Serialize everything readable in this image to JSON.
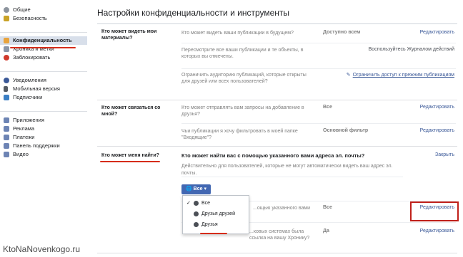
{
  "sidebar": {
    "group1": [
      {
        "label": "Общие",
        "icon": "gear-icon",
        "color": "#7f8c8d"
      },
      {
        "label": "Безопасность",
        "icon": "shield-icon",
        "color": "#c9a227"
      }
    ],
    "group2": [
      {
        "label": "Конфиденциальность",
        "icon": "lock-icon",
        "color": "#e8a33c",
        "active": true
      },
      {
        "label": "Хроника и метки",
        "icon": "timeline-icon",
        "color": "#8a96a8"
      },
      {
        "label": "Заблокировать",
        "icon": "block-icon",
        "color": "#d0392b"
      }
    ],
    "group3": [
      {
        "label": "Уведомления",
        "icon": "globe-icon",
        "color": "#3b5998"
      },
      {
        "label": "Мобильная версия",
        "icon": "mobile-icon",
        "color": "#555b63"
      },
      {
        "label": "Подписчики",
        "icon": "rss-icon",
        "color": "#3b7fc4"
      }
    ],
    "group4": [
      {
        "label": "Приложения",
        "icon": "apps-icon",
        "color": "#6d84b4"
      },
      {
        "label": "Реклама",
        "icon": "ads-icon",
        "color": "#6d84b4"
      },
      {
        "label": "Платежи",
        "icon": "payments-icon",
        "color": "#6d84b4"
      },
      {
        "label": "Панель поддержки",
        "icon": "support-icon",
        "color": "#6d84b4"
      },
      {
        "label": "Видео",
        "icon": "video-icon",
        "color": "#6d84b4"
      }
    ]
  },
  "page": {
    "title": "Настройки конфиденциальности и инструменты"
  },
  "sections": {
    "posts": {
      "label": "Кто может видеть мои материалы?",
      "rows": [
        {
          "question": "Кто может видеть ваши публикации в будущем?",
          "value": "Доступно всем",
          "action": "Редактировать"
        },
        {
          "question": "Пересмотрите все ваши публикации и те объекты, в которых вы отмечены.",
          "value": "",
          "action": "Воспользуйтесь Журналом действий"
        },
        {
          "question": "Ограничить аудиторию публикаций, которые открыты для друзей или всех пользователей?",
          "value": "",
          "action": "Ограничить доступ к прежним публикациям"
        }
      ]
    },
    "contact": {
      "label": "Кто может связаться со мной?",
      "rows": [
        {
          "question": "Кто может отправлять вам запросы на добавление в друзья?",
          "value": "Все",
          "action": "Редактировать"
        },
        {
          "question": "Чьи публикации я хочу фильтровать в моей папке \"Входящие\"?",
          "value": "Основной фильтр",
          "action": "Редактировать"
        }
      ]
    },
    "find": {
      "label": "Кто может меня найти?",
      "open_question": "Кто может найти вас с помощью указанного вами адреса эл. почты?",
      "close_label": "Закрыть",
      "open_desc": "Действительно для пользователей, которые не могут автоматически видеть ваш адрес эл. почты.",
      "select_value": "Все",
      "dropdown_options": [
        {
          "label": "Все",
          "checked": true,
          "icon": "globe-icon"
        },
        {
          "label": "Друзья друзей",
          "checked": false,
          "icon": "friends-of-friends-icon"
        },
        {
          "label": "Друзья",
          "checked": false,
          "icon": "friends-icon"
        }
      ],
      "rows": [
        {
          "question": "...ощью указанного вами",
          "value": "Все",
          "action": "Редактировать"
        },
        {
          "question": "...ковых системах была ссылка на вашу Хронику?",
          "value": "Да",
          "action": "Редактировать"
        }
      ]
    }
  },
  "watermark": "KtoNaNovenkogo.ru",
  "colors": {
    "link": "#3b5998",
    "button": "#4267b2",
    "annotation": "#d62c1a"
  }
}
